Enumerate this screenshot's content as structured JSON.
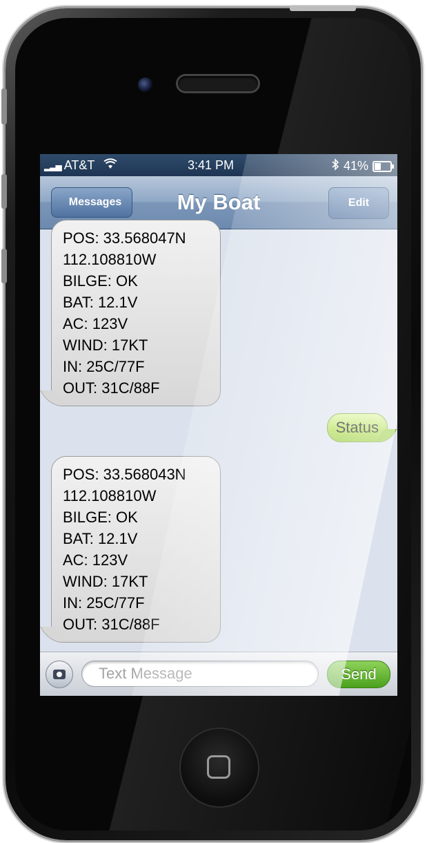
{
  "status_bar": {
    "carrier": "AT&T",
    "time": "3:41 PM",
    "battery": "41%"
  },
  "nav": {
    "back_label": "Messages",
    "title": "My Boat",
    "edit_label": "Edit"
  },
  "messages": {
    "first": [
      "POS: 33.568047N",
      "112.108810W",
      "BILGE: OK",
      "BAT: 12.1V",
      "AC: 123V",
      "WIND: 17KT",
      "IN: 25C/77F",
      "OUT: 31C/88F"
    ],
    "outgoing": "Status",
    "second": [
      "POS: 33.568043N",
      "112.108810W",
      "BILGE: OK",
      "BAT: 12.1V",
      "AC: 123V",
      "WIND: 17KT",
      "IN: 25C/77F",
      "OUT: 31C/88F"
    ]
  },
  "composer": {
    "placeholder": "Text Message",
    "send_label": "Send"
  },
  "icons": {
    "signal": "signal-bars-icon",
    "wifi": "wifi-icon",
    "bluetooth": "bluetooth-icon",
    "battery": "battery-icon",
    "camera": "camera-icon",
    "home": "home-button-icon"
  },
  "colors": {
    "navbar": "#7b96b8",
    "incoming_bubble": "#d7d7d7",
    "outgoing_bubble": "#a6d93a",
    "send_button": "#4aa11c"
  }
}
